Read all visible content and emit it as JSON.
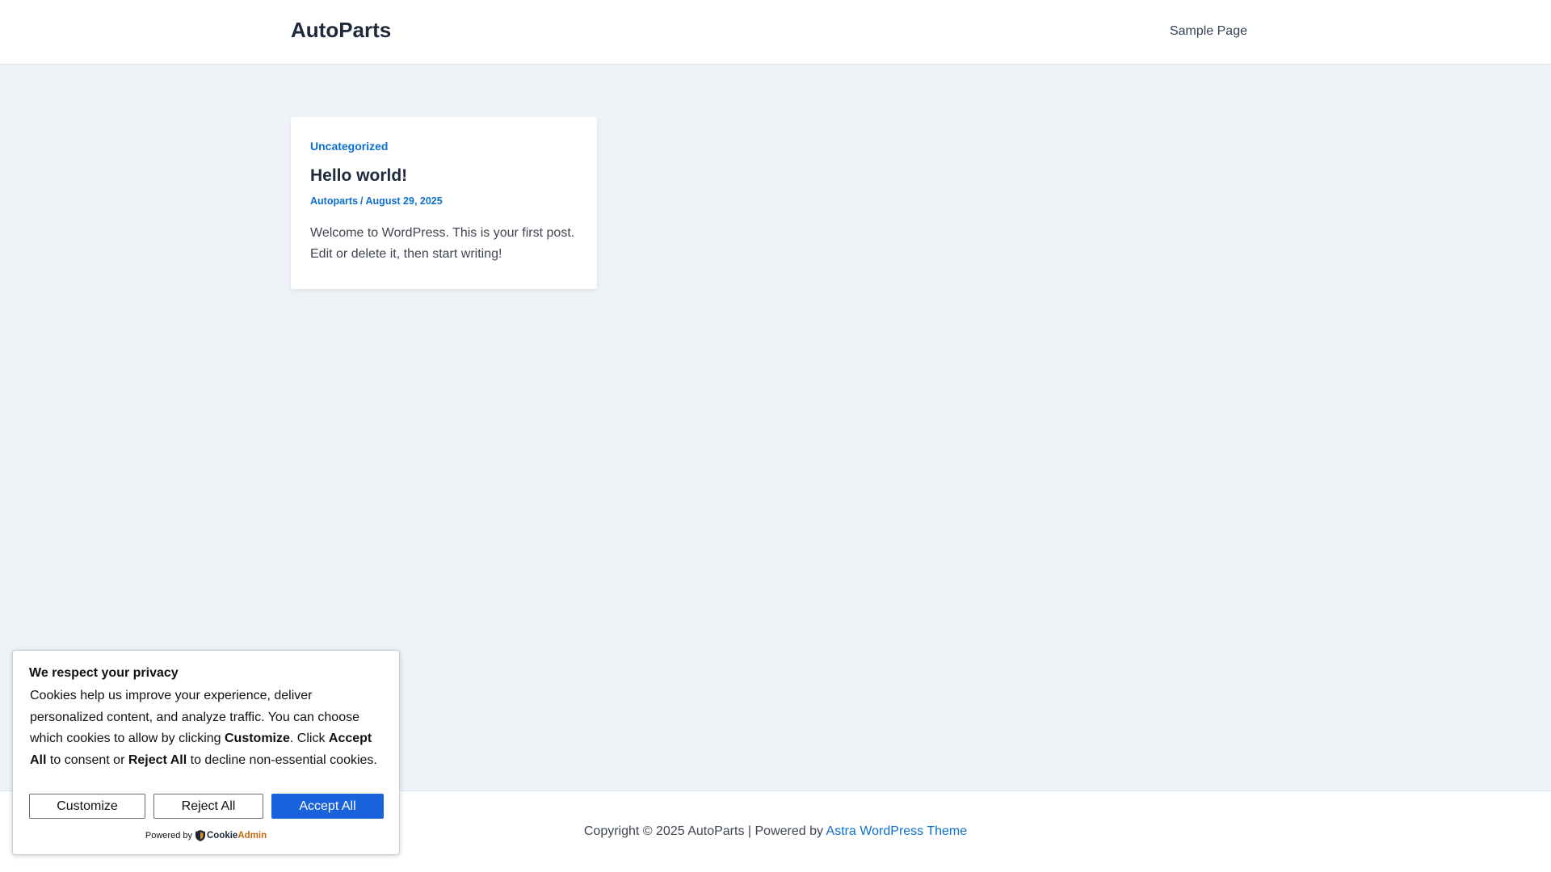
{
  "header": {
    "site_title": "AutoParts",
    "nav": [
      {
        "label": "Sample Page"
      }
    ]
  },
  "post": {
    "category": "Uncategorized",
    "title": "Hello world!",
    "author": "Autoparts",
    "separator": "/",
    "date": "August 29, 2025",
    "excerpt": "Welcome to WordPress. This is your first post. Edit or delete it, then start writing!"
  },
  "footer": {
    "copyright": "Copyright © 2025 AutoParts | Powered by ",
    "theme_link": "Astra WordPress Theme"
  },
  "cookie_banner": {
    "title": "We respect your privacy",
    "body_1": "Cookies help us improve your experience, deliver personalized content, and analyze traffic. You can choose which cookies to allow by clicking ",
    "body_customize": "Customize",
    "body_2": ". Click ",
    "body_accept": "Accept All",
    "body_3": " to consent or ",
    "body_reject": "Reject All",
    "body_4": " to decline non-essential cookies.",
    "buttons": {
      "customize": "Customize",
      "reject": "Reject All",
      "accept": "Accept All"
    },
    "powered_by": "Powered by",
    "brand_a": "Cookie",
    "brand_b": "Admin",
    "brand_icon": "shield-icon"
  },
  "colors": {
    "page_background": "#eef3f8",
    "link_blue": "#0c6fcf",
    "accept_button": "#1863dc",
    "heading": "#1e293b"
  }
}
